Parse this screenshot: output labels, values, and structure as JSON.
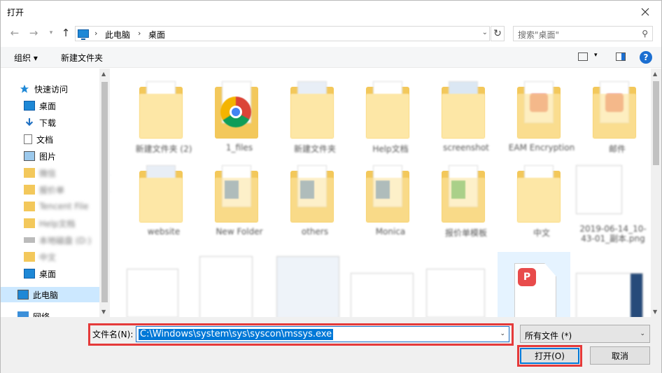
{
  "window": {
    "title": "打开"
  },
  "address": {
    "crumbs": [
      "此电脑",
      "桌面"
    ]
  },
  "search": {
    "placeholder": "搜索\"桌面\""
  },
  "toolbar": {
    "organize": "组织 ▾",
    "new_folder": "新建文件夹"
  },
  "sidebar": {
    "items": [
      {
        "label": "快速访问",
        "icon": "star-icon"
      },
      {
        "label": "桌面",
        "icon": "desktop-icon"
      },
      {
        "label": "下载",
        "icon": "download-icon"
      },
      {
        "label": "文档",
        "icon": "document-icon"
      },
      {
        "label": "图片",
        "icon": "picture-icon"
      },
      {
        "label": "微信",
        "icon": "folder-icon"
      },
      {
        "label": "报价单",
        "icon": "folder-icon"
      },
      {
        "label": "Tencent File",
        "icon": "folder-icon"
      },
      {
        "label": "Help文档",
        "icon": "folder-icon"
      },
      {
        "label": "本地磁盘 (D:)",
        "icon": "drive-icon"
      },
      {
        "label": "中文",
        "icon": "folder-icon"
      },
      {
        "label": "桌面",
        "icon": "desktop-icon"
      },
      {
        "label": "此电脑",
        "icon": "pc-icon"
      },
      {
        "label": "网络",
        "icon": "network-icon"
      }
    ]
  },
  "files": [
    {
      "name": "新建文件夹 (2)",
      "kind": "folder"
    },
    {
      "name": "1_files",
      "kind": "chrome"
    },
    {
      "name": "新建文件夹",
      "kind": "folder"
    },
    {
      "name": "Help文档",
      "kind": "folder"
    },
    {
      "name": "screenshot",
      "kind": "folder"
    },
    {
      "name": "EAM Encryption",
      "kind": "folder-red"
    },
    {
      "name": "邮件",
      "kind": "folder-red"
    },
    {
      "name": "website",
      "kind": "folder"
    },
    {
      "name": "New Folder",
      "kind": "folder-blue"
    },
    {
      "name": "others",
      "kind": "folder-blue"
    },
    {
      "name": "Monica",
      "kind": "folder-blue"
    },
    {
      "name": "报价单模板",
      "kind": "folder-green"
    },
    {
      "name": "中文",
      "kind": "folder"
    },
    {
      "name": "2019-06-14_10-43-01_副本.png",
      "kind": "image"
    },
    {
      "name": "",
      "kind": "image"
    },
    {
      "name": "",
      "kind": "image"
    },
    {
      "name": "",
      "kind": "image"
    },
    {
      "name": "",
      "kind": "image"
    },
    {
      "name": "",
      "kind": "image"
    },
    {
      "name": "",
      "kind": "wps"
    },
    {
      "name": "",
      "kind": "image"
    }
  ],
  "filename": {
    "label": "文件名(N):",
    "value": "C:\\Windows\\system\\sys\\syscon\\mssys.exe"
  },
  "filetype": {
    "value": "所有文件 (*)"
  },
  "buttons": {
    "open": "打开(O)",
    "cancel": "取消"
  },
  "colors": {
    "highlight_red": "#e53a3a",
    "selection_blue": "#0078d7",
    "help_blue": "#1c6fd1"
  }
}
